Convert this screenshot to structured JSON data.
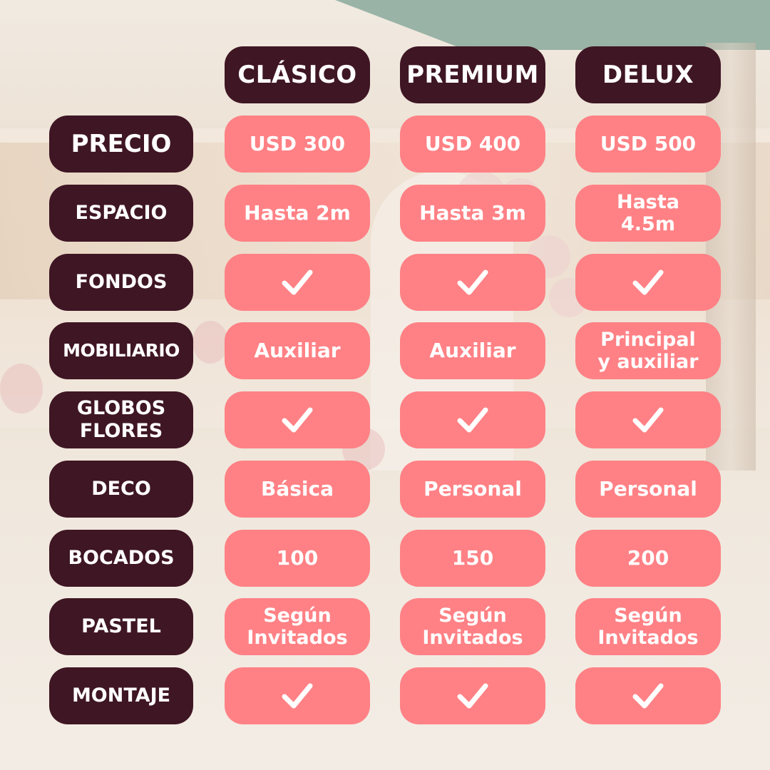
{
  "plans": [
    "CLÁSICO",
    "PREMIUM",
    "DELUX"
  ],
  "rows": [
    {
      "label": "PRECIO",
      "values": [
        "USD 300",
        "USD 400",
        "USD 500"
      ]
    },
    {
      "label": "ESPACIO",
      "values": [
        "Hasta 2m",
        "Hasta 3m",
        "Hasta\n4.5m"
      ]
    },
    {
      "label": "FONDOS",
      "values": [
        "✓",
        "✓",
        "✓"
      ]
    },
    {
      "label": "MOBILIARIO",
      "values": [
        "Auxiliar",
        "Auxiliar",
        "Principal\ny auxiliar"
      ]
    },
    {
      "label": "GLOBOS\nFLORES",
      "values": [
        "✓",
        "✓",
        "✓"
      ]
    },
    {
      "label": "DECO",
      "values": [
        "Básica",
        "Personal",
        "Personal"
      ]
    },
    {
      "label": "BOCADOS",
      "values": [
        "100",
        "150",
        "200"
      ]
    },
    {
      "label": "PASTEL",
      "values": [
        "Según\nInvitados",
        "Según\nInvitados",
        "Según\nInvitados"
      ]
    },
    {
      "label": "MONTAJE",
      "values": [
        "✓",
        "✓",
        "✓"
      ]
    }
  ],
  "colors": {
    "label_bg": "#3f1624",
    "cell_bg": "#ff8185",
    "text": "#ffffff"
  }
}
